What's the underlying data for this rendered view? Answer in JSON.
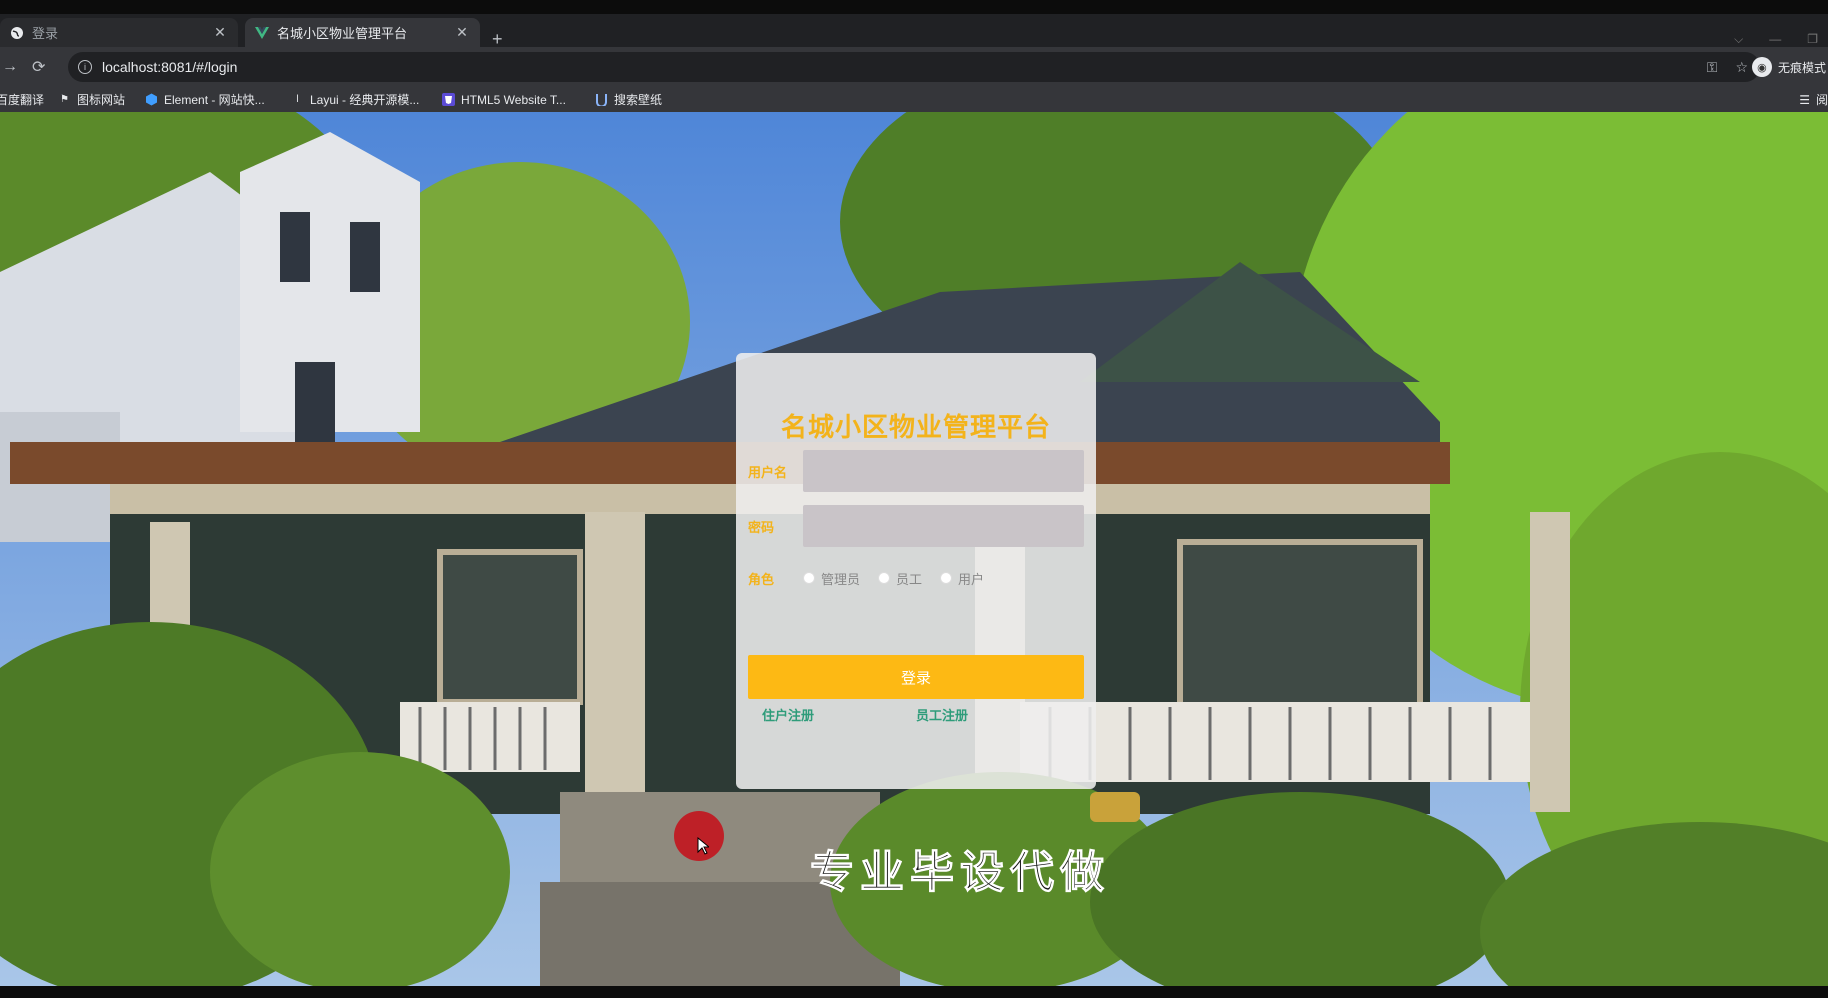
{
  "browser": {
    "tabs": [
      {
        "title": "登录",
        "icon": "globe-icon",
        "active": false
      },
      {
        "title": "名城小区物业管理平台",
        "icon": "vue-icon",
        "active": true
      }
    ],
    "url": "localhost:8081/#/login",
    "profile_label": "无痕模式",
    "bookmarks": [
      {
        "label": "百度翻译",
        "icon": "translate-icon"
      },
      {
        "label": "图标网站",
        "icon": "flag-icon"
      },
      {
        "label": "Element - 网站快...",
        "icon": "element-icon"
      },
      {
        "label": "Layui - 经典开源模...",
        "icon": "layui-icon"
      },
      {
        "label": "HTML5 Website T...",
        "icon": "html5-icon"
      },
      {
        "label": "搜索壁纸",
        "icon": "wallpaper-icon"
      }
    ],
    "reading_list_label": "阅"
  },
  "login": {
    "title": "名城小区物业管理平台",
    "username_label": "用户名",
    "password_label": "密码",
    "role_label": "角色",
    "roles": [
      "管理员",
      "员工",
      "用户"
    ],
    "login_button": "登录",
    "resident_register": "住户注册",
    "staff_register": "员工注册"
  },
  "caption_text": "专业毕设代做",
  "colors": {
    "accent": "#fdb914",
    "title": "#f3b31b",
    "link": "#2e9c7a",
    "card_bg": "#eeeeee",
    "input_bg": "#c9c4c8"
  }
}
